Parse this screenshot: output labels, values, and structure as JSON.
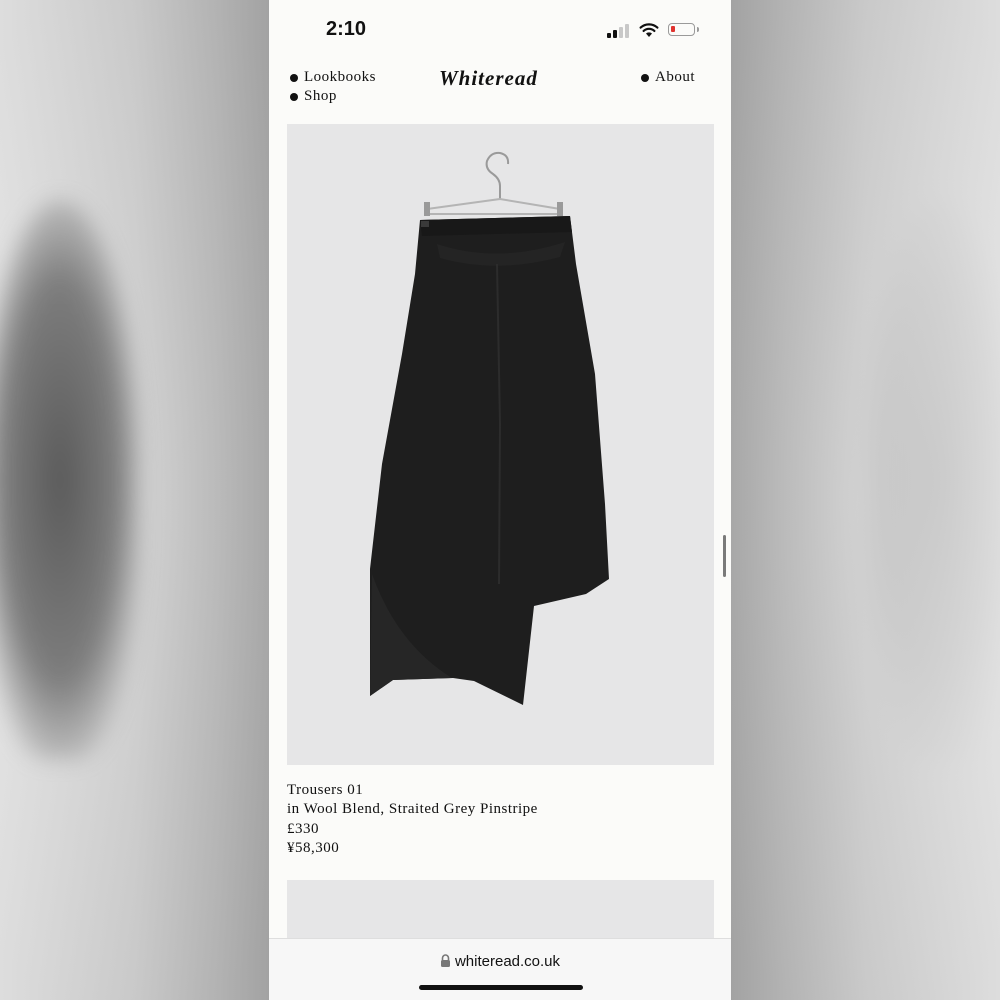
{
  "status": {
    "time": "2:10"
  },
  "nav": {
    "left": [
      "Lookbooks",
      "Shop"
    ],
    "logo": "Whiteread",
    "right": "About"
  },
  "product": {
    "name": "Trousers 01",
    "material": "in Wool Blend, Straited Grey Pinstripe",
    "price_gbp": "£330",
    "price_jpy": "¥58,300"
  },
  "browser": {
    "url": "whiteread.co.uk"
  },
  "colors": {
    "page_bg": "#fbfbf9",
    "image_bg": "#e6e6e7",
    "garment": "#1f1f1f",
    "battery_low": "#e0332f"
  },
  "icons": [
    "signal-icon",
    "wifi-icon",
    "battery-icon",
    "lock-icon",
    "bullet-dot-icon"
  ]
}
